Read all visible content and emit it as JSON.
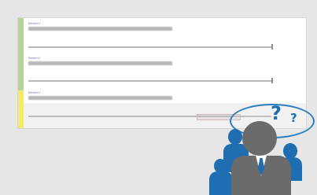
{
  "sections": [
    {
      "label": "Recent I"
    },
    {
      "label": "Recent I"
    },
    {
      "label": "Recent I"
    }
  ],
  "colors": {
    "stripe_green": "#b9d39c",
    "stripe_yellow": "#f1ea6a",
    "label_blue": "#5b78c8",
    "person_blue": "#1f6eb1",
    "person_gray": "#6b6b6b"
  },
  "illustration": {
    "name": "confused-users-illustration",
    "marks": [
      "?",
      "?"
    ]
  }
}
